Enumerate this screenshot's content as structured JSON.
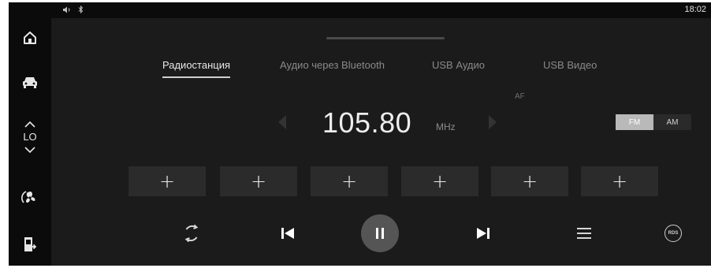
{
  "status_bar": {
    "clock": "18:02",
    "icons": [
      "speaker-icon",
      "bluetooth-icon"
    ]
  },
  "rail": {
    "items": [
      "home-icon",
      "car-icon",
      "climate-up-icon",
      "climate-down-icon",
      "fan-icon",
      "exit-icon"
    ],
    "climate_level": "LO"
  },
  "tabs": [
    {
      "label": "Радиостанция",
      "active": true
    },
    {
      "label": "Аудио через Bluetooth",
      "active": false
    },
    {
      "label": "USB Аудио",
      "active": false
    },
    {
      "label": "USB Видео",
      "active": false
    }
  ],
  "tuner": {
    "af_label": "AF",
    "frequency": "105.80",
    "unit": "MHz",
    "bands": [
      {
        "label": "FM",
        "active": true
      },
      {
        "label": "AM",
        "active": false
      }
    ]
  },
  "presets": [
    {
      "label": "+"
    },
    {
      "label": "+"
    },
    {
      "label": "+"
    },
    {
      "label": "+"
    },
    {
      "label": "+"
    },
    {
      "label": "+"
    }
  ],
  "controls": {
    "icons": [
      "scan-icon",
      "previous-track-icon",
      "pause-icon",
      "next-track-icon",
      "list-icon",
      "rds-icon"
    ],
    "rds_label": "RDS"
  },
  "colors": {
    "background": "#1b1b1b",
    "rail": "#0b0b0b",
    "preset_button": "#2b2b2b",
    "active_band": "#b9b9b9",
    "pause_button": "#555555",
    "text": "#e8e8e8",
    "muted_text": "#8a8a8a"
  }
}
